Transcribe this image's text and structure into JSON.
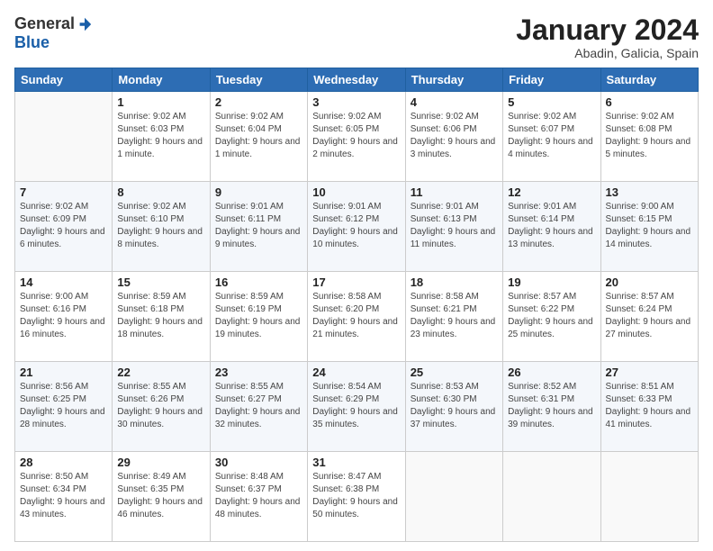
{
  "header": {
    "logo": {
      "general": "General",
      "blue": "Blue"
    },
    "title": "January 2024",
    "subtitle": "Abadin, Galicia, Spain"
  },
  "days_of_week": [
    "Sunday",
    "Monday",
    "Tuesday",
    "Wednesday",
    "Thursday",
    "Friday",
    "Saturday"
  ],
  "weeks": [
    [
      {
        "day": "",
        "sunrise": "",
        "sunset": "",
        "daylight": "",
        "empty": true
      },
      {
        "day": "1",
        "sunrise": "Sunrise: 9:02 AM",
        "sunset": "Sunset: 6:03 PM",
        "daylight": "Daylight: 9 hours and 1 minute."
      },
      {
        "day": "2",
        "sunrise": "Sunrise: 9:02 AM",
        "sunset": "Sunset: 6:04 PM",
        "daylight": "Daylight: 9 hours and 1 minute."
      },
      {
        "day": "3",
        "sunrise": "Sunrise: 9:02 AM",
        "sunset": "Sunset: 6:05 PM",
        "daylight": "Daylight: 9 hours and 2 minutes."
      },
      {
        "day": "4",
        "sunrise": "Sunrise: 9:02 AM",
        "sunset": "Sunset: 6:06 PM",
        "daylight": "Daylight: 9 hours and 3 minutes."
      },
      {
        "day": "5",
        "sunrise": "Sunrise: 9:02 AM",
        "sunset": "Sunset: 6:07 PM",
        "daylight": "Daylight: 9 hours and 4 minutes."
      },
      {
        "day": "6",
        "sunrise": "Sunrise: 9:02 AM",
        "sunset": "Sunset: 6:08 PM",
        "daylight": "Daylight: 9 hours and 5 minutes."
      }
    ],
    [
      {
        "day": "7",
        "sunrise": "Sunrise: 9:02 AM",
        "sunset": "Sunset: 6:09 PM",
        "daylight": "Daylight: 9 hours and 6 minutes."
      },
      {
        "day": "8",
        "sunrise": "Sunrise: 9:02 AM",
        "sunset": "Sunset: 6:10 PM",
        "daylight": "Daylight: 9 hours and 8 minutes."
      },
      {
        "day": "9",
        "sunrise": "Sunrise: 9:01 AM",
        "sunset": "Sunset: 6:11 PM",
        "daylight": "Daylight: 9 hours and 9 minutes."
      },
      {
        "day": "10",
        "sunrise": "Sunrise: 9:01 AM",
        "sunset": "Sunset: 6:12 PM",
        "daylight": "Daylight: 9 hours and 10 minutes."
      },
      {
        "day": "11",
        "sunrise": "Sunrise: 9:01 AM",
        "sunset": "Sunset: 6:13 PM",
        "daylight": "Daylight: 9 hours and 11 minutes."
      },
      {
        "day": "12",
        "sunrise": "Sunrise: 9:01 AM",
        "sunset": "Sunset: 6:14 PM",
        "daylight": "Daylight: 9 hours and 13 minutes."
      },
      {
        "day": "13",
        "sunrise": "Sunrise: 9:00 AM",
        "sunset": "Sunset: 6:15 PM",
        "daylight": "Daylight: 9 hours and 14 minutes."
      }
    ],
    [
      {
        "day": "14",
        "sunrise": "Sunrise: 9:00 AM",
        "sunset": "Sunset: 6:16 PM",
        "daylight": "Daylight: 9 hours and 16 minutes."
      },
      {
        "day": "15",
        "sunrise": "Sunrise: 8:59 AM",
        "sunset": "Sunset: 6:18 PM",
        "daylight": "Daylight: 9 hours and 18 minutes."
      },
      {
        "day": "16",
        "sunrise": "Sunrise: 8:59 AM",
        "sunset": "Sunset: 6:19 PM",
        "daylight": "Daylight: 9 hours and 19 minutes."
      },
      {
        "day": "17",
        "sunrise": "Sunrise: 8:58 AM",
        "sunset": "Sunset: 6:20 PM",
        "daylight": "Daylight: 9 hours and 21 minutes."
      },
      {
        "day": "18",
        "sunrise": "Sunrise: 8:58 AM",
        "sunset": "Sunset: 6:21 PM",
        "daylight": "Daylight: 9 hours and 23 minutes."
      },
      {
        "day": "19",
        "sunrise": "Sunrise: 8:57 AM",
        "sunset": "Sunset: 6:22 PM",
        "daylight": "Daylight: 9 hours and 25 minutes."
      },
      {
        "day": "20",
        "sunrise": "Sunrise: 8:57 AM",
        "sunset": "Sunset: 6:24 PM",
        "daylight": "Daylight: 9 hours and 27 minutes."
      }
    ],
    [
      {
        "day": "21",
        "sunrise": "Sunrise: 8:56 AM",
        "sunset": "Sunset: 6:25 PM",
        "daylight": "Daylight: 9 hours and 28 minutes."
      },
      {
        "day": "22",
        "sunrise": "Sunrise: 8:55 AM",
        "sunset": "Sunset: 6:26 PM",
        "daylight": "Daylight: 9 hours and 30 minutes."
      },
      {
        "day": "23",
        "sunrise": "Sunrise: 8:55 AM",
        "sunset": "Sunset: 6:27 PM",
        "daylight": "Daylight: 9 hours and 32 minutes."
      },
      {
        "day": "24",
        "sunrise": "Sunrise: 8:54 AM",
        "sunset": "Sunset: 6:29 PM",
        "daylight": "Daylight: 9 hours and 35 minutes."
      },
      {
        "day": "25",
        "sunrise": "Sunrise: 8:53 AM",
        "sunset": "Sunset: 6:30 PM",
        "daylight": "Daylight: 9 hours and 37 minutes."
      },
      {
        "day": "26",
        "sunrise": "Sunrise: 8:52 AM",
        "sunset": "Sunset: 6:31 PM",
        "daylight": "Daylight: 9 hours and 39 minutes."
      },
      {
        "day": "27",
        "sunrise": "Sunrise: 8:51 AM",
        "sunset": "Sunset: 6:33 PM",
        "daylight": "Daylight: 9 hours and 41 minutes."
      }
    ],
    [
      {
        "day": "28",
        "sunrise": "Sunrise: 8:50 AM",
        "sunset": "Sunset: 6:34 PM",
        "daylight": "Daylight: 9 hours and 43 minutes."
      },
      {
        "day": "29",
        "sunrise": "Sunrise: 8:49 AM",
        "sunset": "Sunset: 6:35 PM",
        "daylight": "Daylight: 9 hours and 46 minutes."
      },
      {
        "day": "30",
        "sunrise": "Sunrise: 8:48 AM",
        "sunset": "Sunset: 6:37 PM",
        "daylight": "Daylight: 9 hours and 48 minutes."
      },
      {
        "day": "31",
        "sunrise": "Sunrise: 8:47 AM",
        "sunset": "Sunset: 6:38 PM",
        "daylight": "Daylight: 9 hours and 50 minutes."
      },
      {
        "day": "",
        "sunrise": "",
        "sunset": "",
        "daylight": "",
        "empty": true
      },
      {
        "day": "",
        "sunrise": "",
        "sunset": "",
        "daylight": "",
        "empty": true
      },
      {
        "day": "",
        "sunrise": "",
        "sunset": "",
        "daylight": "",
        "empty": true
      }
    ]
  ]
}
